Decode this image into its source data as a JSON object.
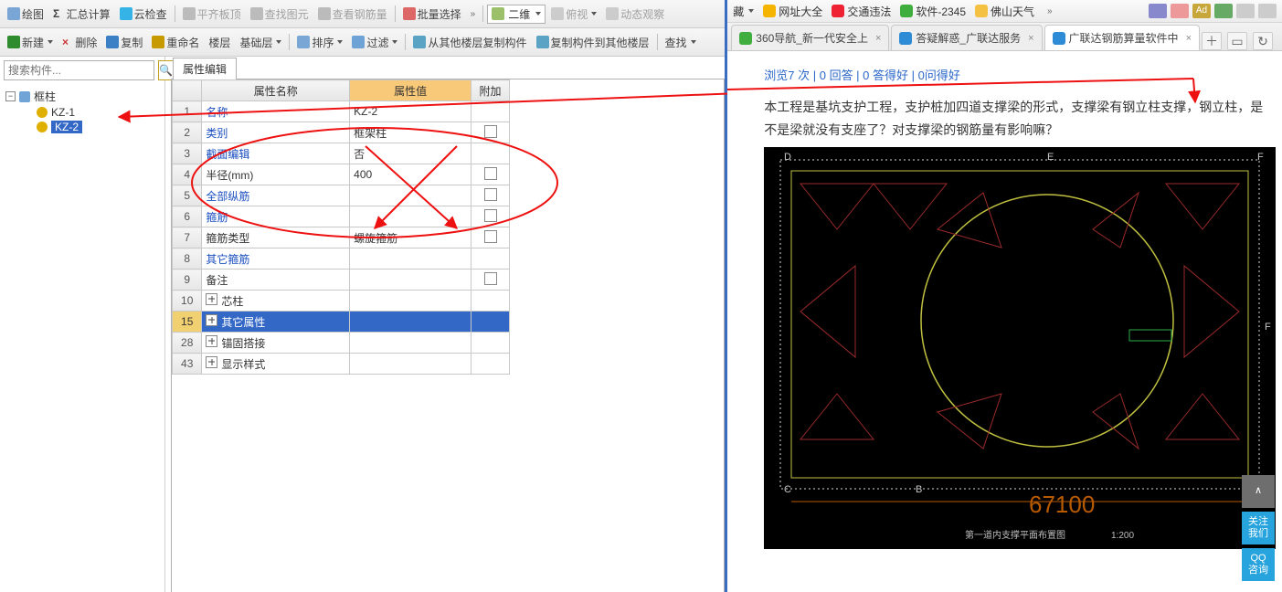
{
  "toolbar1": {
    "draw": "绘图",
    "sum": "汇总计算",
    "cloud_check": "云检查",
    "flat_top": "平齐板顶",
    "find_elem": "查找图元",
    "view_rebar": "查看钢筋量",
    "batch_select": "批量选择",
    "view_mode": "二维",
    "top_view": "俯视",
    "dyn_view": "动态观察"
  },
  "toolbar2": {
    "new": "新建",
    "delete": "删除",
    "copy": "复制",
    "rename": "重命名",
    "floor": "楼层",
    "base_floor": "基础层",
    "sort": "排序",
    "filter": "过滤",
    "copy_from_other": "从其他楼层复制构件",
    "copy_to_other": "复制构件到其他楼层",
    "find": "查找"
  },
  "search_placeholder": "搜索构件...",
  "tree": {
    "root": "框柱",
    "children": [
      "KZ-1",
      "KZ-2"
    ],
    "selected": "KZ-2"
  },
  "prop_tab": "属性编辑",
  "prop_headers": {
    "name": "属性名称",
    "value": "属性值",
    "extra": "附加"
  },
  "prop_rows": [
    {
      "num": "1",
      "name": "名称",
      "value": "KZ-2",
      "link": true,
      "chk": false
    },
    {
      "num": "2",
      "name": "类别",
      "value": "框架柱",
      "link": true,
      "chk": true
    },
    {
      "num": "3",
      "name": "截面编辑",
      "value": "否",
      "link": true,
      "chk": false
    },
    {
      "num": "4",
      "name": "半径(mm)",
      "value": "400",
      "link": false,
      "chk": true
    },
    {
      "num": "5",
      "name": "全部纵筋",
      "value": "",
      "link": true,
      "chk": true
    },
    {
      "num": "6",
      "name": "箍筋",
      "value": "",
      "link": true,
      "chk": true
    },
    {
      "num": "7",
      "name": "箍筋类型",
      "value": "螺旋箍筋",
      "link": false,
      "chk": true
    },
    {
      "num": "8",
      "name": "其它箍筋",
      "value": "",
      "link": true,
      "chk": false
    },
    {
      "num": "9",
      "name": "备注",
      "value": "",
      "link": false,
      "chk": true
    },
    {
      "num": "10",
      "name": "芯柱",
      "value": "",
      "link": false,
      "chk": false,
      "plus": true
    },
    {
      "num": "15",
      "name": "其它属性",
      "value": "",
      "link": false,
      "chk": false,
      "plus": true,
      "selected": true
    },
    {
      "num": "28",
      "name": "锚固搭接",
      "value": "",
      "link": false,
      "chk": false,
      "plus": true
    },
    {
      "num": "43",
      "name": "显示样式",
      "value": "",
      "link": false,
      "chk": false,
      "plus": true
    }
  ],
  "bookmarks": {
    "fav": "藏",
    "netnav": "网址大全",
    "traffic": "交通违法",
    "soft": "软件-2345",
    "weather": "佛山天气"
  },
  "tabs": [
    {
      "title": "360导航_新一代安全上",
      "active": false
    },
    {
      "title": "答疑解惑_广联达服务",
      "active": false
    },
    {
      "title": "广联达钢筋算量软件中",
      "active": true
    }
  ],
  "stats": "浏览7 次 | 0 回答 | 0 答得好 | 0问得好",
  "question": "本工程是基坑支护工程，支护桩加四道支撑梁的形式，支撑梁有钢立柱支撑，钢立柱，是不是梁就没有支座了？对支撑梁的钢筋量有影响嘛？",
  "cad": {
    "big_number": "67100",
    "scale": "1:200"
  },
  "float": {
    "top": "∧",
    "follow": "关注\n我们",
    "qq": "QQ\n咨询"
  }
}
